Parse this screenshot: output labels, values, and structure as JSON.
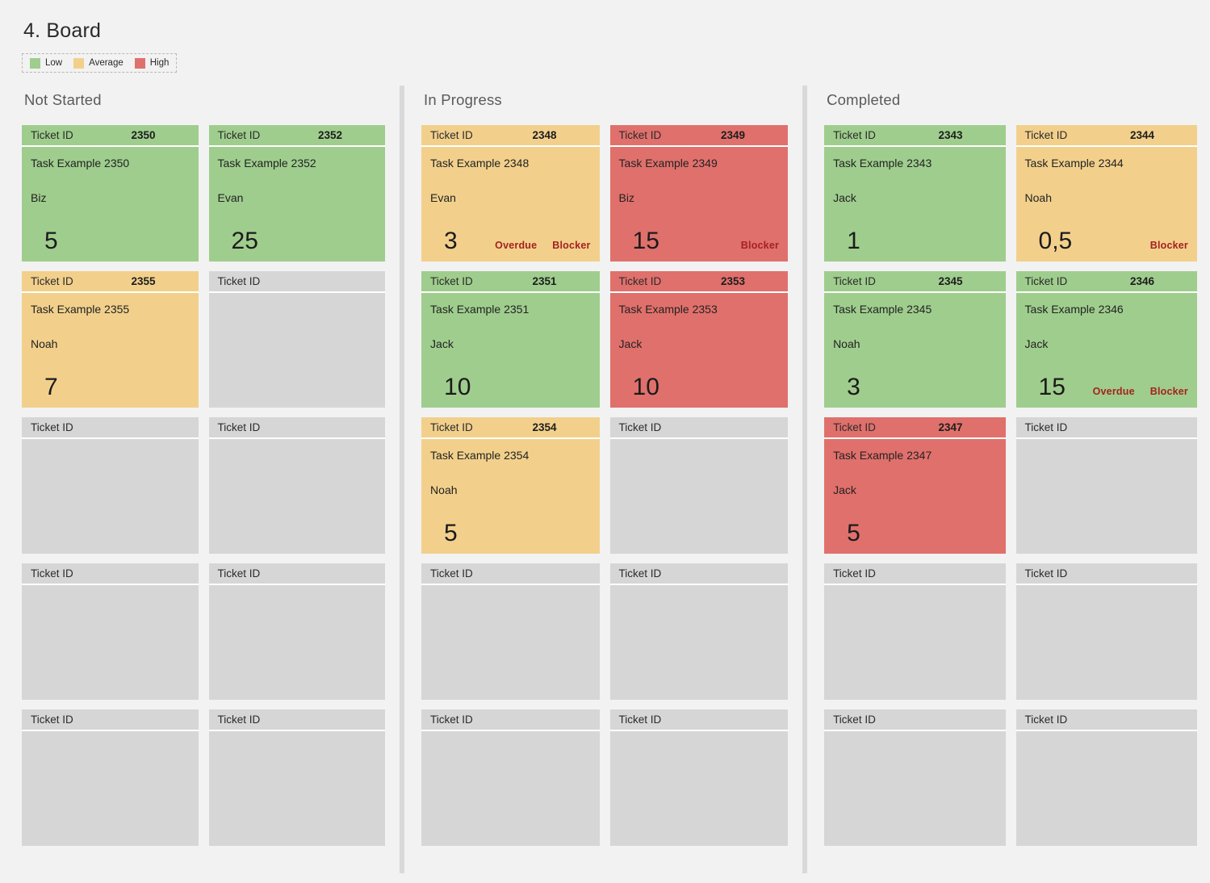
{
  "title": "4. Board",
  "legend": {
    "items": [
      {
        "label": "Low",
        "color": "#9fcd8d"
      },
      {
        "label": "Average",
        "color": "#f2d08c"
      },
      {
        "label": "High",
        "color": "#e0706c"
      }
    ]
  },
  "card_labels": {
    "ticket_id": "Ticket ID",
    "overdue": "Overdue",
    "blocker": "Blocker"
  },
  "columns": [
    {
      "title": "Not Started",
      "cards": [
        {
          "ticket_id": "2350",
          "task": "Task Example 2350",
          "assignee": "Biz",
          "value": "5",
          "priority": "Low",
          "overdue": false,
          "blocker": false,
          "empty": false
        },
        {
          "ticket_id": "2352",
          "task": "Task Example 2352",
          "assignee": "Evan",
          "value": "25",
          "priority": "Low",
          "overdue": false,
          "blocker": false,
          "empty": false
        },
        {
          "ticket_id": "2355",
          "task": "Task Example 2355",
          "assignee": "Noah",
          "value": "7",
          "priority": "Average",
          "overdue": false,
          "blocker": false,
          "empty": false
        },
        {
          "ticket_id": "",
          "task": "",
          "assignee": "",
          "value": "",
          "priority": "",
          "overdue": false,
          "blocker": false,
          "empty": true
        },
        {
          "ticket_id": "",
          "task": "",
          "assignee": "",
          "value": "",
          "priority": "",
          "overdue": false,
          "blocker": false,
          "empty": true
        },
        {
          "ticket_id": "",
          "task": "",
          "assignee": "",
          "value": "",
          "priority": "",
          "overdue": false,
          "blocker": false,
          "empty": true
        },
        {
          "ticket_id": "",
          "task": "",
          "assignee": "",
          "value": "",
          "priority": "",
          "overdue": false,
          "blocker": false,
          "empty": true
        },
        {
          "ticket_id": "",
          "task": "",
          "assignee": "",
          "value": "",
          "priority": "",
          "overdue": false,
          "blocker": false,
          "empty": true
        },
        {
          "ticket_id": "",
          "task": "",
          "assignee": "",
          "value": "",
          "priority": "",
          "overdue": false,
          "blocker": false,
          "empty": true
        },
        {
          "ticket_id": "",
          "task": "",
          "assignee": "",
          "value": "",
          "priority": "",
          "overdue": false,
          "blocker": false,
          "empty": true
        }
      ]
    },
    {
      "title": "In Progress",
      "cards": [
        {
          "ticket_id": "2348",
          "task": "Task Example 2348",
          "assignee": "Evan",
          "value": "3",
          "priority": "Average",
          "overdue": true,
          "blocker": true,
          "empty": false
        },
        {
          "ticket_id": "2349",
          "task": "Task Example 2349",
          "assignee": "Biz",
          "value": "15",
          "priority": "High",
          "overdue": false,
          "blocker": true,
          "empty": false
        },
        {
          "ticket_id": "2351",
          "task": "Task Example 2351",
          "assignee": "Jack",
          "value": "10",
          "priority": "Low",
          "overdue": false,
          "blocker": false,
          "empty": false
        },
        {
          "ticket_id": "2353",
          "task": "Task Example 2353",
          "assignee": "Jack",
          "value": "10",
          "priority": "High",
          "overdue": false,
          "blocker": false,
          "empty": false
        },
        {
          "ticket_id": "2354",
          "task": "Task Example 2354",
          "assignee": "Noah",
          "value": "5",
          "priority": "Average",
          "overdue": false,
          "blocker": false,
          "empty": false
        },
        {
          "ticket_id": "",
          "task": "",
          "assignee": "",
          "value": "",
          "priority": "",
          "overdue": false,
          "blocker": false,
          "empty": true
        },
        {
          "ticket_id": "",
          "task": "",
          "assignee": "",
          "value": "",
          "priority": "",
          "overdue": false,
          "blocker": false,
          "empty": true
        },
        {
          "ticket_id": "",
          "task": "",
          "assignee": "",
          "value": "",
          "priority": "",
          "overdue": false,
          "blocker": false,
          "empty": true
        },
        {
          "ticket_id": "",
          "task": "",
          "assignee": "",
          "value": "",
          "priority": "",
          "overdue": false,
          "blocker": false,
          "empty": true
        },
        {
          "ticket_id": "",
          "task": "",
          "assignee": "",
          "value": "",
          "priority": "",
          "overdue": false,
          "blocker": false,
          "empty": true
        }
      ]
    },
    {
      "title": "Completed",
      "cards": [
        {
          "ticket_id": "2343",
          "task": "Task Example 2343",
          "assignee": "Jack",
          "value": "1",
          "priority": "Low",
          "overdue": false,
          "blocker": false,
          "empty": false
        },
        {
          "ticket_id": "2344",
          "task": "Task Example 2344",
          "assignee": "Noah",
          "value": "0,5",
          "priority": "Average",
          "overdue": false,
          "blocker": true,
          "empty": false
        },
        {
          "ticket_id": "2345",
          "task": "Task Example 2345",
          "assignee": "Noah",
          "value": "3",
          "priority": "Low",
          "overdue": false,
          "blocker": false,
          "empty": false
        },
        {
          "ticket_id": "2346",
          "task": "Task Example 2346",
          "assignee": "Jack",
          "value": "15",
          "priority": "Low",
          "overdue": true,
          "blocker": true,
          "empty": false
        },
        {
          "ticket_id": "2347",
          "task": "Task Example 2347",
          "assignee": "Jack",
          "value": "5",
          "priority": "High",
          "overdue": false,
          "blocker": false,
          "empty": false
        },
        {
          "ticket_id": "",
          "task": "",
          "assignee": "",
          "value": "",
          "priority": "",
          "overdue": false,
          "blocker": false,
          "empty": true
        },
        {
          "ticket_id": "",
          "task": "",
          "assignee": "",
          "value": "",
          "priority": "",
          "overdue": false,
          "blocker": false,
          "empty": true
        },
        {
          "ticket_id": "",
          "task": "",
          "assignee": "",
          "value": "",
          "priority": "",
          "overdue": false,
          "blocker": false,
          "empty": true
        },
        {
          "ticket_id": "",
          "task": "",
          "assignee": "",
          "value": "",
          "priority": "",
          "overdue": false,
          "blocker": false,
          "empty": true
        },
        {
          "ticket_id": "",
          "task": "",
          "assignee": "",
          "value": "",
          "priority": "",
          "overdue": false,
          "blocker": false,
          "empty": true
        }
      ]
    }
  ]
}
